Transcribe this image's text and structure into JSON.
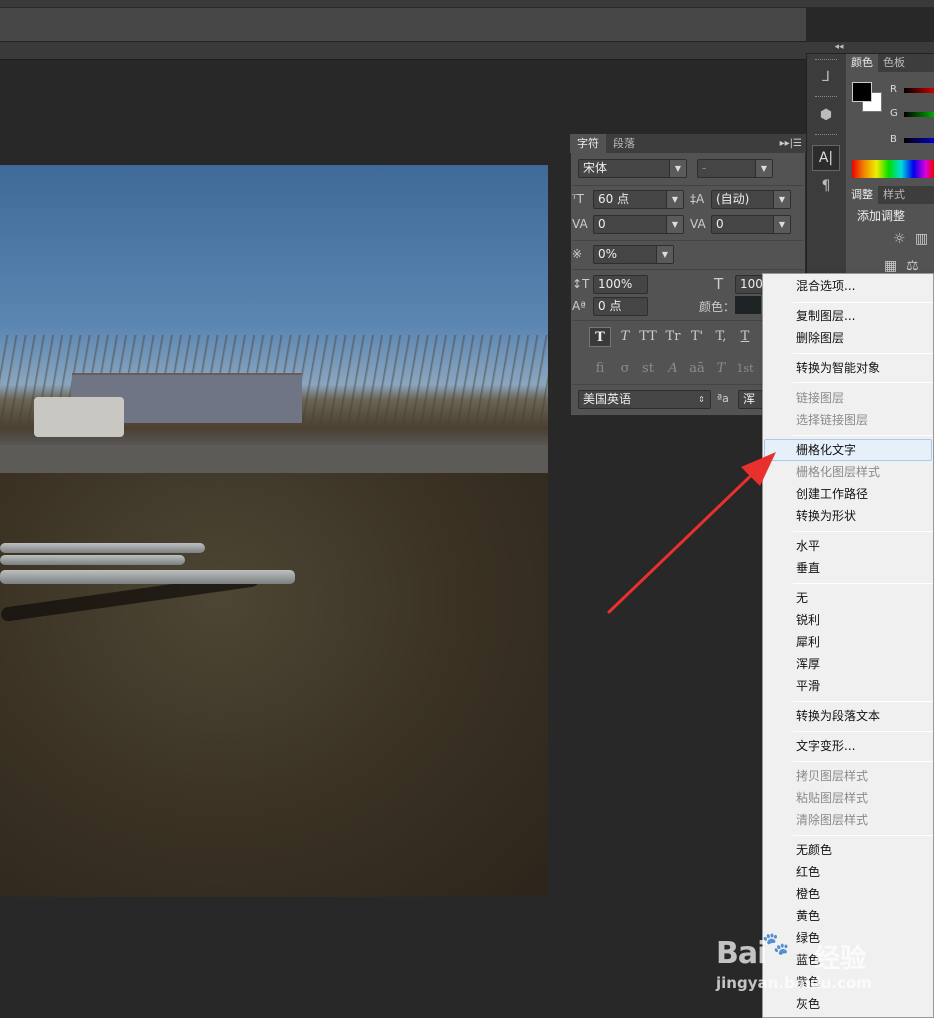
{
  "character_panel": {
    "tabs": [
      "字符",
      "段落"
    ],
    "menu_glyph": "▸▸|☰",
    "font_family": "宋体",
    "font_style": "-",
    "font_size": "60 点",
    "leading": "(自动)",
    "kerning": "0",
    "tracking": "0",
    "tsume": "0%",
    "vertical_scale": "100%",
    "horizontal_scale": "100%",
    "baseline_shift": "0 点",
    "color_label": "颜色：",
    "language": "美国英语",
    "anti_alias_icon_text": "ªa",
    "anti_alias": "浑",
    "type_styles": [
      "T",
      "T",
      "TT",
      "Tr",
      "T'",
      "T,",
      "T"
    ],
    "opentype": [
      "fi",
      "σ",
      "st",
      "A",
      "aā",
      "T",
      "1st"
    ]
  },
  "right_panel": {
    "color_tabs": [
      "颜色",
      "色板"
    ],
    "channels": [
      "R",
      "G",
      "B"
    ],
    "adjust_tabs": [
      "调整",
      "样式"
    ],
    "adjust_title": "添加调整"
  },
  "context_menu": {
    "items": [
      {
        "label": "混合选项...",
        "disabled": false
      },
      {
        "label": "复制图层...",
        "disabled": false
      },
      {
        "label": "删除图层",
        "disabled": false
      },
      {
        "label": "转换为智能对象",
        "disabled": false
      },
      {
        "label": "链接图层",
        "disabled": true
      },
      {
        "label": "选择链接图层",
        "disabled": true
      },
      {
        "label": "栅格化文字",
        "disabled": false,
        "highlighted": true
      },
      {
        "label": "栅格化图层样式",
        "disabled": true
      },
      {
        "label": "创建工作路径",
        "disabled": false
      },
      {
        "label": "转换为形状",
        "disabled": false
      },
      {
        "label": "水平",
        "disabled": false
      },
      {
        "label": "垂直",
        "disabled": false
      },
      {
        "label": "无",
        "disabled": false
      },
      {
        "label": "锐利",
        "disabled": false
      },
      {
        "label": "犀利",
        "disabled": false
      },
      {
        "label": "浑厚",
        "disabled": false
      },
      {
        "label": "平滑",
        "disabled": false
      },
      {
        "label": "转换为段落文本",
        "disabled": false
      },
      {
        "label": "文字变形...",
        "disabled": false
      },
      {
        "label": "拷贝图层样式",
        "disabled": true
      },
      {
        "label": "粘贴图层样式",
        "disabled": true
      },
      {
        "label": "清除图层样式",
        "disabled": true
      },
      {
        "label": "无颜色",
        "disabled": false
      },
      {
        "label": "红色",
        "disabled": false
      },
      {
        "label": "橙色",
        "disabled": false
      },
      {
        "label": "黄色",
        "disabled": false
      },
      {
        "label": "绿色",
        "disabled": false
      },
      {
        "label": "蓝色",
        "disabled": false
      },
      {
        "label": "紫色",
        "disabled": false
      },
      {
        "label": "灰色",
        "disabled": false
      }
    ]
  },
  "watermark": {
    "brand": "Bai",
    "brand_suffix": "经验",
    "url": "jingyan.baidu.com"
  },
  "colors": {
    "annotation_arrow": "#e8302c",
    "menu_highlight": "#e5f0fb"
  }
}
